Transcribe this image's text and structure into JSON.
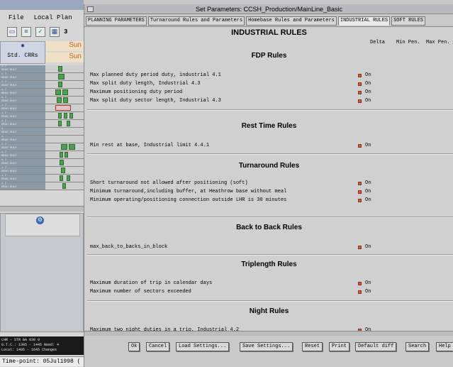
{
  "left_window": {
    "menu": [
      "File",
      "Local Plan"
    ],
    "tool_value": "3",
    "info_label": "Std. CRRs",
    "day_labels": [
      "Sun",
      "Sun"
    ],
    "status_lines": [
      "LHR - STR  BA 930       0",
      "G.T.C.: 1305 - 1445  Need: 4",
      "Local: 1405 - 1645  Changes"
    ],
    "time_point": "Time-point: 05Jul1998 ("
  },
  "dialog": {
    "title": "Set Parameters: CCSH_Production/MainLine_Basic",
    "tabs": [
      {
        "label": "PLANNING PARAMETERS",
        "active": false
      },
      {
        "label": "Turnaround Rules and Parameters",
        "active": false
      },
      {
        "label": "Homebase Rules and Parameters",
        "active": false
      },
      {
        "label": "INDUSTRIAL RULES",
        "active": true
      },
      {
        "label": "SOFT RULES",
        "active": false
      }
    ],
    "page_title": "INDUSTRIAL RULES",
    "columns": {
      "delta": "Delta",
      "min_pen": "Min Pen.",
      "max_pen": "Max Pen."
    },
    "on_label": "On",
    "sections": [
      {
        "title": "FDP Rules",
        "rules": [
          "Max planned duty period duty, industrial 4.1",
          "Max split duty  length, Industrial 4.3",
          "Maximum positioning duty period",
          "Max split duty sector length, Industrial 4.3"
        ]
      },
      {
        "title": "Rest Time Rules",
        "rules": [
          "Min rest at base, Industrial limit 4.4.1"
        ]
      },
      {
        "title": "Turnaround Rules",
        "rules": [
          "Short turnaround not allowed after positioning (soft)",
          "Minimum turnaround,including buffer, at Heathrow base without meal",
          "Minimum operating/positioning connection outside LHR is 30 minutes"
        ]
      },
      {
        "title": "Back to Back Rules",
        "rules": [
          "max_back_to_backs_in_block"
        ]
      },
      {
        "title": "Triplength Rules",
        "rules": [
          "Maximum duration of trip in calendar days",
          "Maximum number of sectors exceeded"
        ]
      },
      {
        "title": "Night Rules",
        "rules": [
          "Maximum two night duties in a trip, Industrial 4.2"
        ]
      }
    ],
    "buttons": [
      "Ok",
      "Cancel",
      "Load Settings...",
      "Save Settings...",
      "Reset",
      "Print",
      "Default diff",
      "Search",
      "Help"
    ]
  }
}
